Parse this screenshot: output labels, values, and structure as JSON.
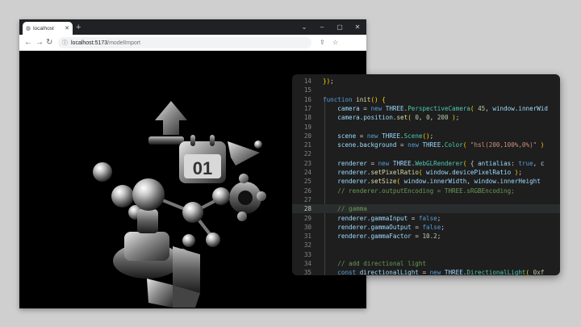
{
  "browser": {
    "tab": {
      "title": "localhost",
      "close_icon": "close-icon",
      "favicon": "globe-icon"
    },
    "new_tab_symbol": "+",
    "window_controls": [
      "⌄",
      "–",
      "▢",
      "✕"
    ],
    "nav": {
      "back": "←",
      "forward": "→",
      "reload": "↻"
    },
    "address": {
      "host": "localhost:5173",
      "path": "/modelImport"
    },
    "toolbar_icons": [
      "share-icon",
      "star-icon"
    ]
  },
  "viewport": {
    "label_on_calendar": "01",
    "background": "#000000"
  },
  "editor": {
    "background": "#1e1e1e",
    "active_line": 28,
    "lines": [
      {
        "n": "14",
        "t": [
          [
            "p",
            "})"
          ],
          [
            "",
            ";"
          ]
        ]
      },
      {
        "n": "15",
        "t": []
      },
      {
        "n": "16",
        "t": [
          [
            "k",
            "function "
          ],
          [
            "f",
            "init"
          ],
          [
            "p",
            "()"
          ],
          [
            "",
            " "
          ],
          [
            "p",
            "{"
          ]
        ]
      },
      {
        "n": "17",
        "t": [
          [
            "",
            "    "
          ],
          [
            "v",
            "camera"
          ],
          [
            "",
            " = "
          ],
          [
            "k",
            "new "
          ],
          [
            "v",
            "THREE"
          ],
          [
            "",
            "."
          ],
          [
            "c",
            "PerspectiveCamera"
          ],
          [
            "p",
            "("
          ],
          [
            "",
            " "
          ],
          [
            "n",
            "45"
          ],
          [
            ",",
            ", "
          ],
          [
            "v",
            "window"
          ],
          [
            "",
            "."
          ],
          [
            "v",
            "innerWid"
          ]
        ]
      },
      {
        "n": "18",
        "t": [
          [
            "",
            "    "
          ],
          [
            "v",
            "camera"
          ],
          [
            "",
            "."
          ],
          [
            "v",
            "position"
          ],
          [
            "",
            "."
          ],
          [
            "f",
            "set"
          ],
          [
            "p",
            "("
          ],
          [
            "",
            " "
          ],
          [
            "n",
            "0"
          ],
          [
            "",
            ", "
          ],
          [
            "n",
            "0"
          ],
          [
            "",
            ", "
          ],
          [
            "n",
            "200"
          ],
          [
            "",
            " "
          ],
          [
            "p",
            ")"
          ],
          [
            "",
            ";"
          ]
        ]
      },
      {
        "n": "19",
        "t": []
      },
      {
        "n": "20",
        "t": [
          [
            "",
            "    "
          ],
          [
            "v",
            "scene"
          ],
          [
            "",
            " = "
          ],
          [
            "k",
            "new "
          ],
          [
            "v",
            "THREE"
          ],
          [
            "",
            "."
          ],
          [
            "c",
            "Scene"
          ],
          [
            "p",
            "()"
          ],
          [
            "",
            ";"
          ]
        ]
      },
      {
        "n": "21",
        "t": [
          [
            "",
            "    "
          ],
          [
            "v",
            "scene"
          ],
          [
            "",
            "."
          ],
          [
            "v",
            "background"
          ],
          [
            "",
            " = "
          ],
          [
            "k",
            "new "
          ],
          [
            "v",
            "THREE"
          ],
          [
            "",
            "."
          ],
          [
            "c",
            "Color"
          ],
          [
            "p",
            "("
          ],
          [
            "",
            " "
          ],
          [
            "s",
            "\"hsl(200,100%,0%)\""
          ],
          [
            "",
            " "
          ],
          [
            "p",
            ")"
          ]
        ]
      },
      {
        "n": "22",
        "t": []
      },
      {
        "n": "23",
        "t": [
          [
            "",
            "    "
          ],
          [
            "v",
            "renderer"
          ],
          [
            "",
            " = "
          ],
          [
            "k",
            "new "
          ],
          [
            "v",
            "THREE"
          ],
          [
            "",
            "."
          ],
          [
            "c",
            "WebGLRenderer"
          ],
          [
            "p",
            "("
          ],
          [
            "",
            " { "
          ],
          [
            "v",
            "antialias"
          ],
          [
            "",
            ": "
          ],
          [
            "k",
            "true"
          ],
          [
            "",
            ", c"
          ]
        ]
      },
      {
        "n": "24",
        "t": [
          [
            "",
            "    "
          ],
          [
            "v",
            "renderer"
          ],
          [
            "",
            "."
          ],
          [
            "f",
            "setPixelRatio"
          ],
          [
            "p",
            "("
          ],
          [
            "",
            " "
          ],
          [
            "v",
            "window"
          ],
          [
            "",
            "."
          ],
          [
            "v",
            "devicePixelRatio"
          ],
          [
            "",
            " "
          ],
          [
            "p",
            ")"
          ],
          [
            "",
            ";"
          ]
        ]
      },
      {
        "n": "25",
        "t": [
          [
            "",
            "    "
          ],
          [
            "v",
            "renderer"
          ],
          [
            "",
            "."
          ],
          [
            "f",
            "setSize"
          ],
          [
            "p",
            "("
          ],
          [
            "",
            " "
          ],
          [
            "v",
            "window"
          ],
          [
            "",
            "."
          ],
          [
            "v",
            "innerWidth"
          ],
          [
            "",
            ", "
          ],
          [
            "v",
            "window"
          ],
          [
            "",
            "."
          ],
          [
            "v",
            "innerHeight"
          ]
        ]
      },
      {
        "n": "26",
        "t": [
          [
            "",
            "    "
          ],
          [
            "cm",
            "// renderer.outputEncoding = THREE.sRGBEncoding;"
          ]
        ]
      },
      {
        "n": "27",
        "t": []
      },
      {
        "n": "28",
        "t": [
          [
            "",
            "    "
          ],
          [
            "cm",
            "// gamma"
          ]
        ]
      },
      {
        "n": "29",
        "t": [
          [
            "",
            "    "
          ],
          [
            "v",
            "renderer"
          ],
          [
            "",
            "."
          ],
          [
            "v",
            "gammaInput"
          ],
          [
            "",
            " = "
          ],
          [
            "k",
            "false"
          ],
          [
            "",
            ";"
          ]
        ]
      },
      {
        "n": "30",
        "t": [
          [
            "",
            "    "
          ],
          [
            "v",
            "renderer"
          ],
          [
            "",
            "."
          ],
          [
            "v",
            "gammaOutput"
          ],
          [
            "",
            " = "
          ],
          [
            "k",
            "false"
          ],
          [
            "",
            ";"
          ]
        ]
      },
      {
        "n": "31",
        "t": [
          [
            "",
            "    "
          ],
          [
            "v",
            "renderer"
          ],
          [
            "",
            "."
          ],
          [
            "v",
            "gammaFactor"
          ],
          [
            "",
            " = "
          ],
          [
            "n",
            "10.2"
          ],
          [
            "",
            ";"
          ]
        ]
      },
      {
        "n": "32",
        "t": []
      },
      {
        "n": "33",
        "t": []
      },
      {
        "n": "34",
        "t": [
          [
            "",
            "    "
          ],
          [
            "cm",
            "// add directional light"
          ]
        ]
      },
      {
        "n": "35",
        "t": [
          [
            "",
            "    "
          ],
          [
            "k",
            "const "
          ],
          [
            "v",
            "directionalLight"
          ],
          [
            "",
            " = "
          ],
          [
            "k",
            "new "
          ],
          [
            "v",
            "THREE"
          ],
          [
            "",
            "."
          ],
          [
            "c",
            "DirectionalLight"
          ],
          [
            "p",
            "("
          ],
          [
            "",
            " "
          ],
          [
            "n",
            "0xf"
          ]
        ]
      }
    ]
  }
}
